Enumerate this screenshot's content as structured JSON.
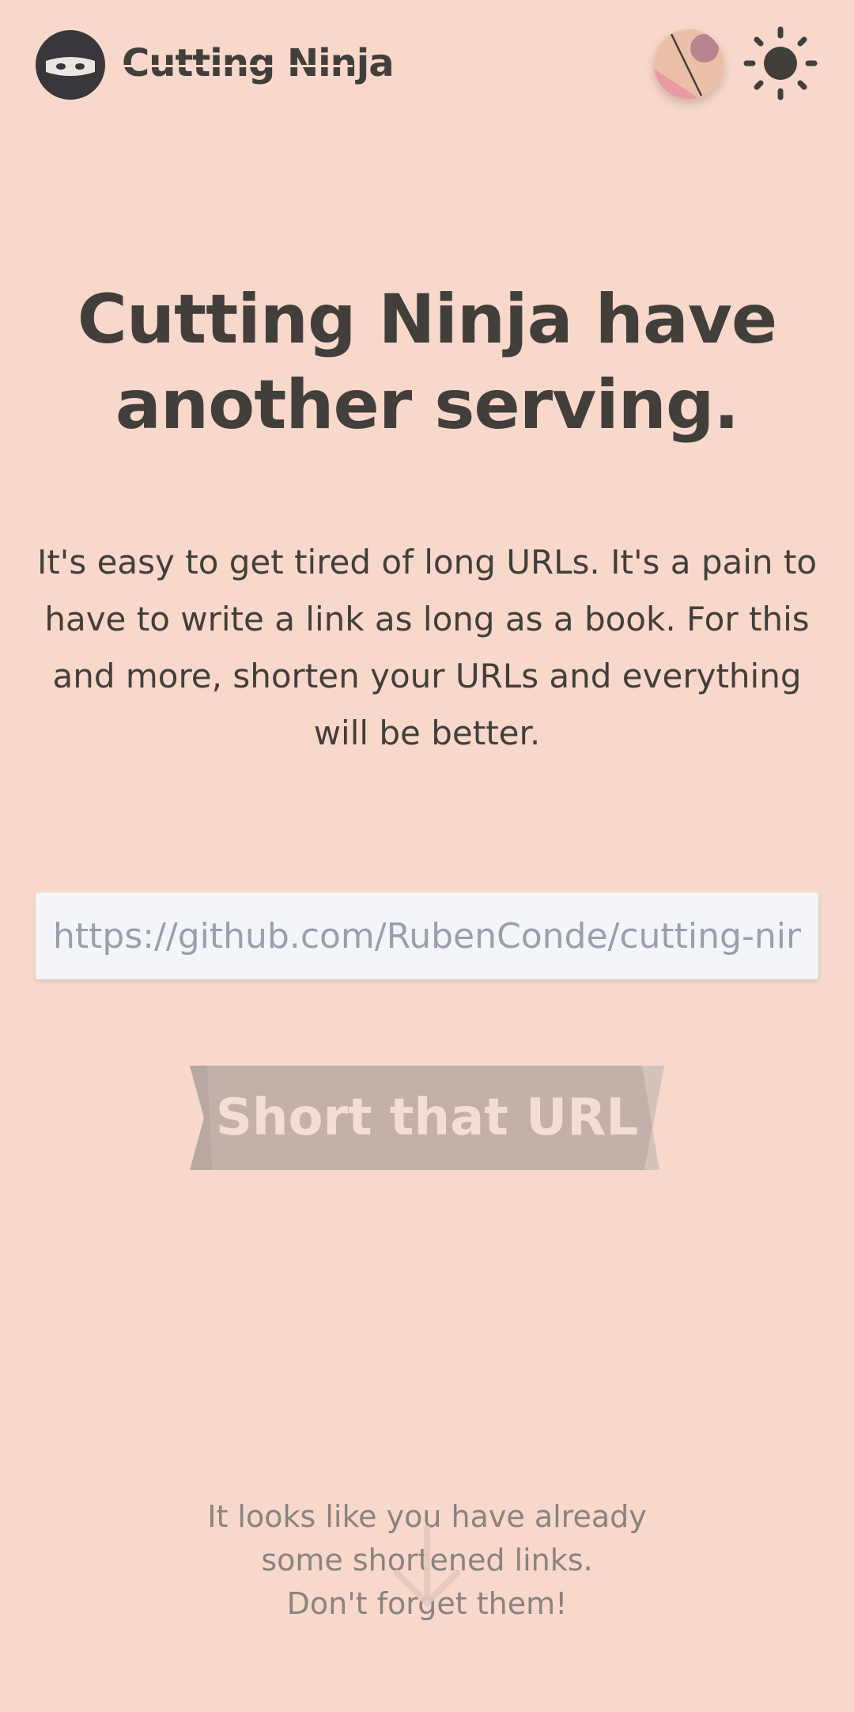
{
  "header": {
    "brand": "Cutting Ninja",
    "logo_icon": "ninja-icon",
    "palette_icon": "palette-icon",
    "theme_icon": "sun-icon"
  },
  "hero": {
    "title_line1": "Cutting Ninja have",
    "title_line2": "another serving.",
    "description": "It's easy to get tired of long URLs. It's a pain to have to write a link as long as a book. For this and more, shorten your URLs and everything will be better."
  },
  "form": {
    "url_placeholder": "https://github.com/RubenConde/cutting-ninja",
    "url_value": "",
    "submit_label": "Short that URL"
  },
  "footer": {
    "line1": "It looks like you have already",
    "line2": "some shortened links.",
    "line3": "Don't forget them!",
    "arrow_icon": "arrow-down-icon"
  },
  "colors": {
    "background": "#f8d8cb",
    "text": "#423f3b",
    "input_bg": "#f3f5f8",
    "button_bg": "#c3b0aa",
    "button_text": "#f3ded6",
    "muted_text": "#8a8380"
  }
}
